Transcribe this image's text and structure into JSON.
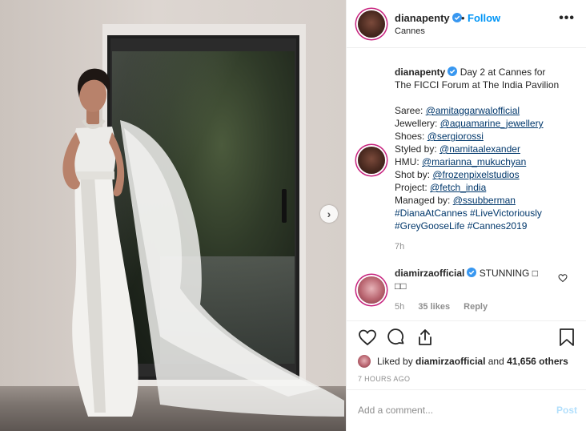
{
  "header": {
    "username": "dianapenty",
    "separator": "•",
    "follow_label": "Follow",
    "location": "Cannes",
    "more_label": "•••"
  },
  "caption": {
    "username": "dianapenty",
    "line1": "Day 2 at Cannes for",
    "line2": "The FICCI Forum at The India Pavilion",
    "credits": [
      {
        "label": "Saree: ",
        "handle": "@amitaggarwalofficial"
      },
      {
        "label": "Jewellery: ",
        "handle": "@aquamarine_jewellery"
      },
      {
        "label": "Shoes: ",
        "handle": "@sergiorossi"
      },
      {
        "label": "Styled by: ",
        "handle": "@namitaalexander"
      },
      {
        "label": "HMU: ",
        "handle": "@marianna_mukuchyan"
      },
      {
        "label": "Shot by: ",
        "handle": "@frozenpixelstudios"
      },
      {
        "label": "Project: ",
        "handle": "@fetch_india"
      },
      {
        "label": "Managed by: ",
        "handle": "@ssubberman"
      }
    ],
    "hashtags_line1": "#DianaAtCannes #LiveVictoriously",
    "hashtags_line2": "#GreyGooseLife #Cannes2019",
    "time": "7h"
  },
  "comment": {
    "username": "diamirzaofficial",
    "text": "STUNNING □",
    "text_line2": "□□",
    "time": "5h",
    "likes": "35 likes",
    "reply": "Reply"
  },
  "likes": {
    "prefix": "Liked by ",
    "user": "diamirzaofficial",
    "middle": " and ",
    "count": "41,656 others"
  },
  "post_date": "7 HOURS AGO",
  "add_comment": {
    "placeholder": "Add a comment...",
    "post_label": "Post"
  },
  "colors": {
    "accent": "#0095f6",
    "link": "#00376b",
    "muted": "#8e8e8e",
    "story_ring": "#c7237e"
  }
}
